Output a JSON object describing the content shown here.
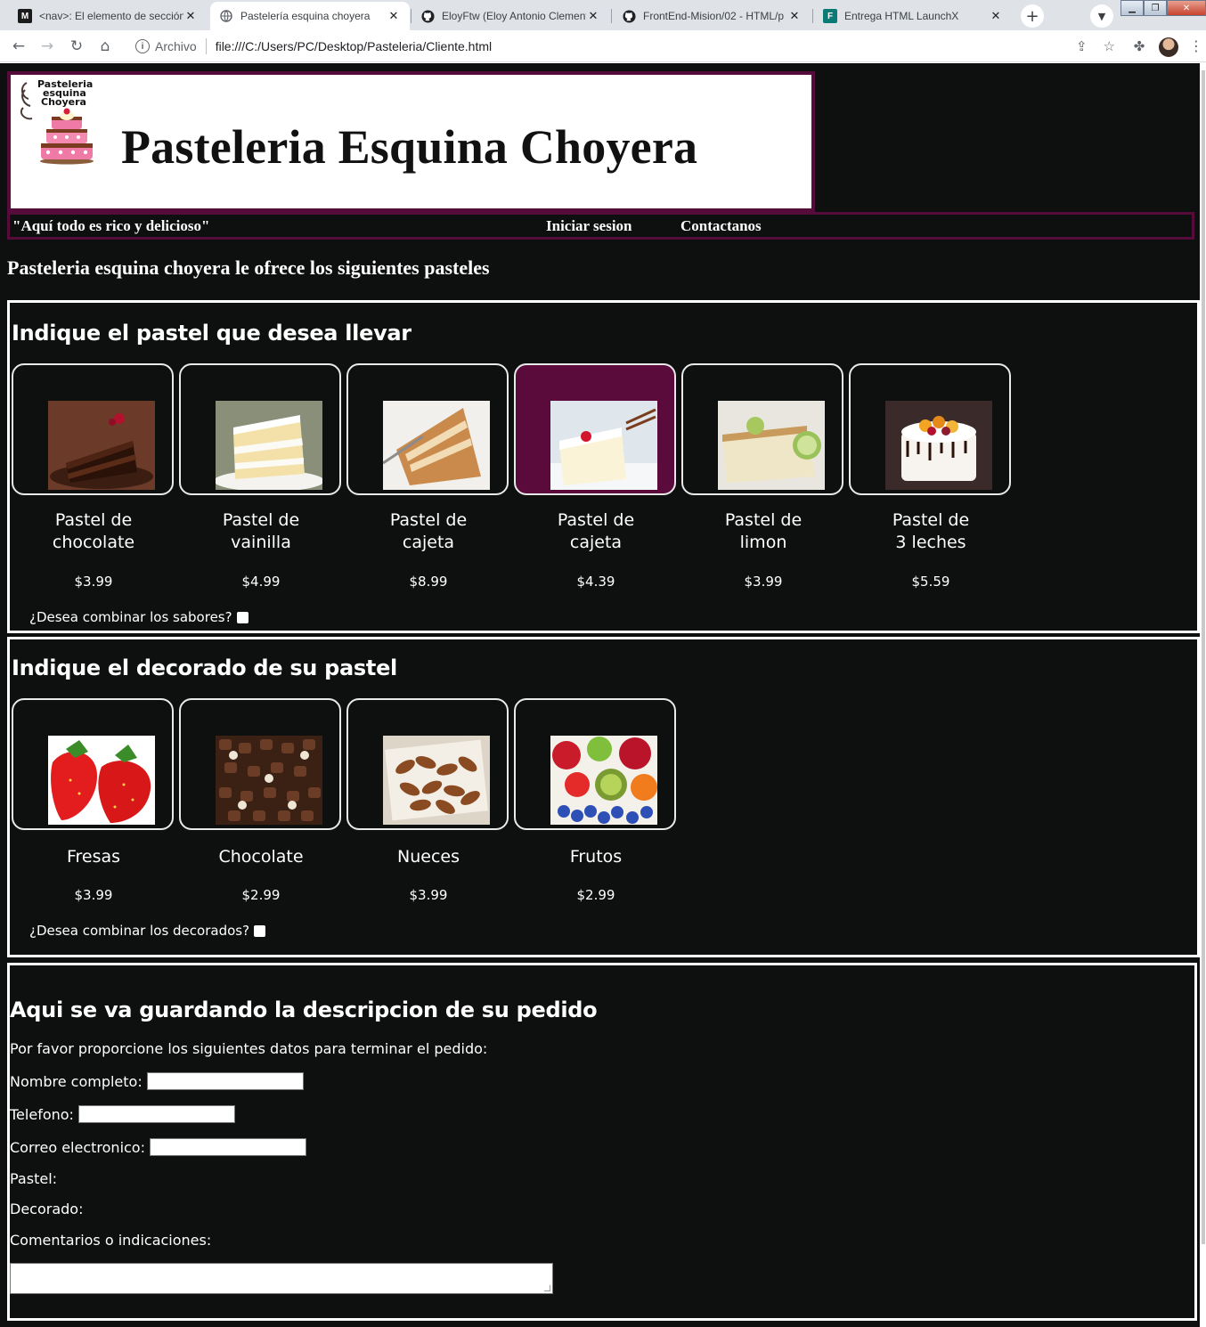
{
  "browser": {
    "tabs": [
      {
        "title": "<nav>: El elemento de sección",
        "icon": "mdn-icon"
      },
      {
        "title": "Pastelería esquina choyera",
        "icon": "globe-icon",
        "active": true
      },
      {
        "title": "EloyFtw (Eloy Antonio Clement",
        "icon": "github-icon"
      },
      {
        "title": "FrontEnd-Mision/02 - HTML/p",
        "icon": "github-icon"
      },
      {
        "title": "Entrega HTML LaunchX",
        "icon": "forms-icon"
      }
    ],
    "scheme_label": "Archivo",
    "url": "file:///C:/Users/PC/Desktop/Pasteleria/Cliente.html"
  },
  "header": {
    "logo_text": [
      "Pasteleria",
      "esquina",
      "Choyera"
    ],
    "title": "Pasteleria Esquina Choyera"
  },
  "nav": {
    "slogan": "\"Aquí todo es rico y delicioso\"",
    "login": "Iniciar sesion",
    "contact": "Contactanos"
  },
  "intro": "Pasteleria esquina choyera le ofrece los siguientes pasteles",
  "cakes": {
    "title": "Indique el pastel que desea llevar",
    "items": [
      {
        "name_line1": "Pastel de",
        "name_line2": "chocolate",
        "price": "$3.99",
        "selected": false
      },
      {
        "name_line1": "Pastel de",
        "name_line2": "vainilla",
        "price": "$4.99",
        "selected": false
      },
      {
        "name_line1": "Pastel de",
        "name_line2": "cajeta",
        "price": "$8.99",
        "selected": false
      },
      {
        "name_line1": "Pastel de",
        "name_line2": "cajeta",
        "price": "$4.39",
        "selected": true
      },
      {
        "name_line1": "Pastel de",
        "name_line2": "limon",
        "price": "$3.99",
        "selected": false
      },
      {
        "name_line1": "Pastel de",
        "name_line2": "3 leches",
        "price": "$5.59",
        "selected": false
      }
    ],
    "combine_label": "¿Desea combinar los sabores?"
  },
  "decorations": {
    "title": "Indique el decorado de su pastel",
    "items": [
      {
        "name": "Fresas",
        "price": "$3.99"
      },
      {
        "name": "Chocolate",
        "price": "$2.99"
      },
      {
        "name": "Nueces",
        "price": "$3.99"
      },
      {
        "name": "Frutos",
        "price": "$2.99"
      }
    ],
    "combine_label": "¿Desea combinar los decorados?"
  },
  "order": {
    "title": "Aqui se va guardando la descripcion de su pedido",
    "prompt": "Por favor proporcione los siguientes datos para terminar el pedido:",
    "name_label": "Nombre completo:",
    "phone_label": "Telefono:",
    "email_label": "Correo electronico:",
    "cake_label": "Pastel:",
    "decor_label": "Decorado:",
    "comments_label": "Comentarios o indicaciones:"
  },
  "colors": {
    "page_bg": "#0d100f",
    "accent": "#560c3b",
    "selected_card": "#5a0b3c"
  }
}
